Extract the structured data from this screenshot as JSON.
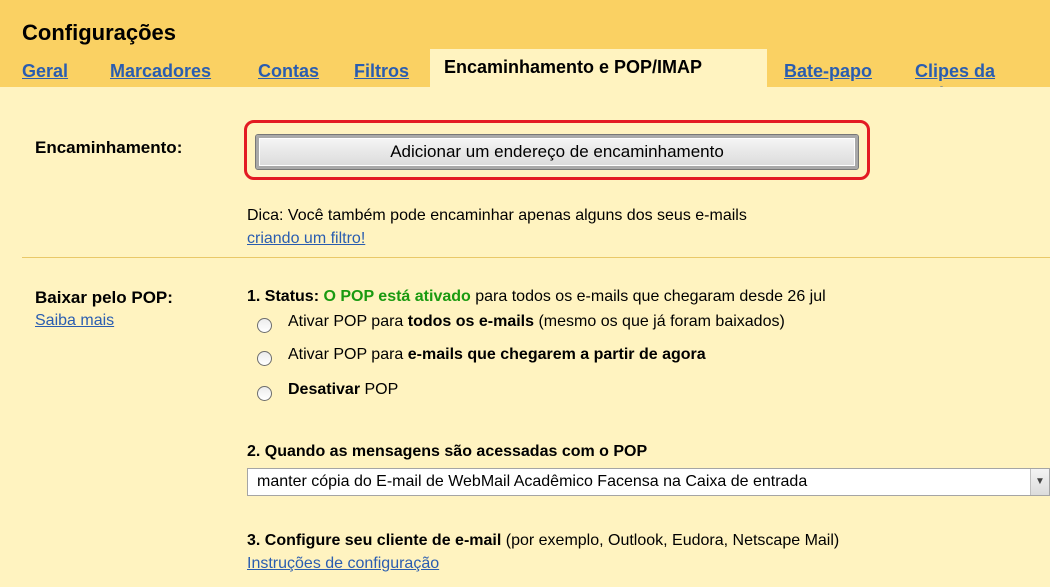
{
  "header": {
    "title": "Configurações",
    "tabs": [
      {
        "label": "Geral"
      },
      {
        "label": "Marcadores"
      },
      {
        "label": "Contas"
      },
      {
        "label": "Filtros"
      },
      {
        "label": "Encaminhamento e POP/IMAP"
      },
      {
        "label": "Bate-papo"
      },
      {
        "label": "Clipes da web"
      }
    ]
  },
  "forwarding": {
    "label": "Encaminhamento:",
    "button_label": "Adicionar um endereço de encaminhamento",
    "tip_text": "Dica: Você também pode encaminhar apenas alguns dos seus e-mails",
    "tip_link": "criando um filtro!"
  },
  "pop": {
    "label": "Baixar pelo POP:",
    "learn_more": "Saiba mais",
    "status_prefix": "1. Status:",
    "status_value": "O POP está ativado",
    "status_suffix": "para todos os e-mails que chegaram desde 26 jul",
    "options": [
      {
        "pre": "Ativar POP para",
        "bold": "todos os e-mails",
        "post": "(mesmo os que já foram baixados)"
      },
      {
        "pre": "Ativar POP para",
        "bold": "e-mails que chegarem a partir de agora",
        "post": ""
      },
      {
        "pre": "",
        "bold": "Desativar",
        "post": "POP"
      }
    ],
    "when_accessed_heading": "2. Quando as mensagens são acessadas com o POP",
    "when_accessed_value": "manter cópia do E-mail de WebMail Acadêmico Facensa na Caixa de entrada",
    "configure_heading": "3. Configure seu cliente de e-mail",
    "configure_note": "(por exemplo, Outlook, Eudora, Netscape Mail)",
    "instructions_link": "Instruções de configuração"
  }
}
